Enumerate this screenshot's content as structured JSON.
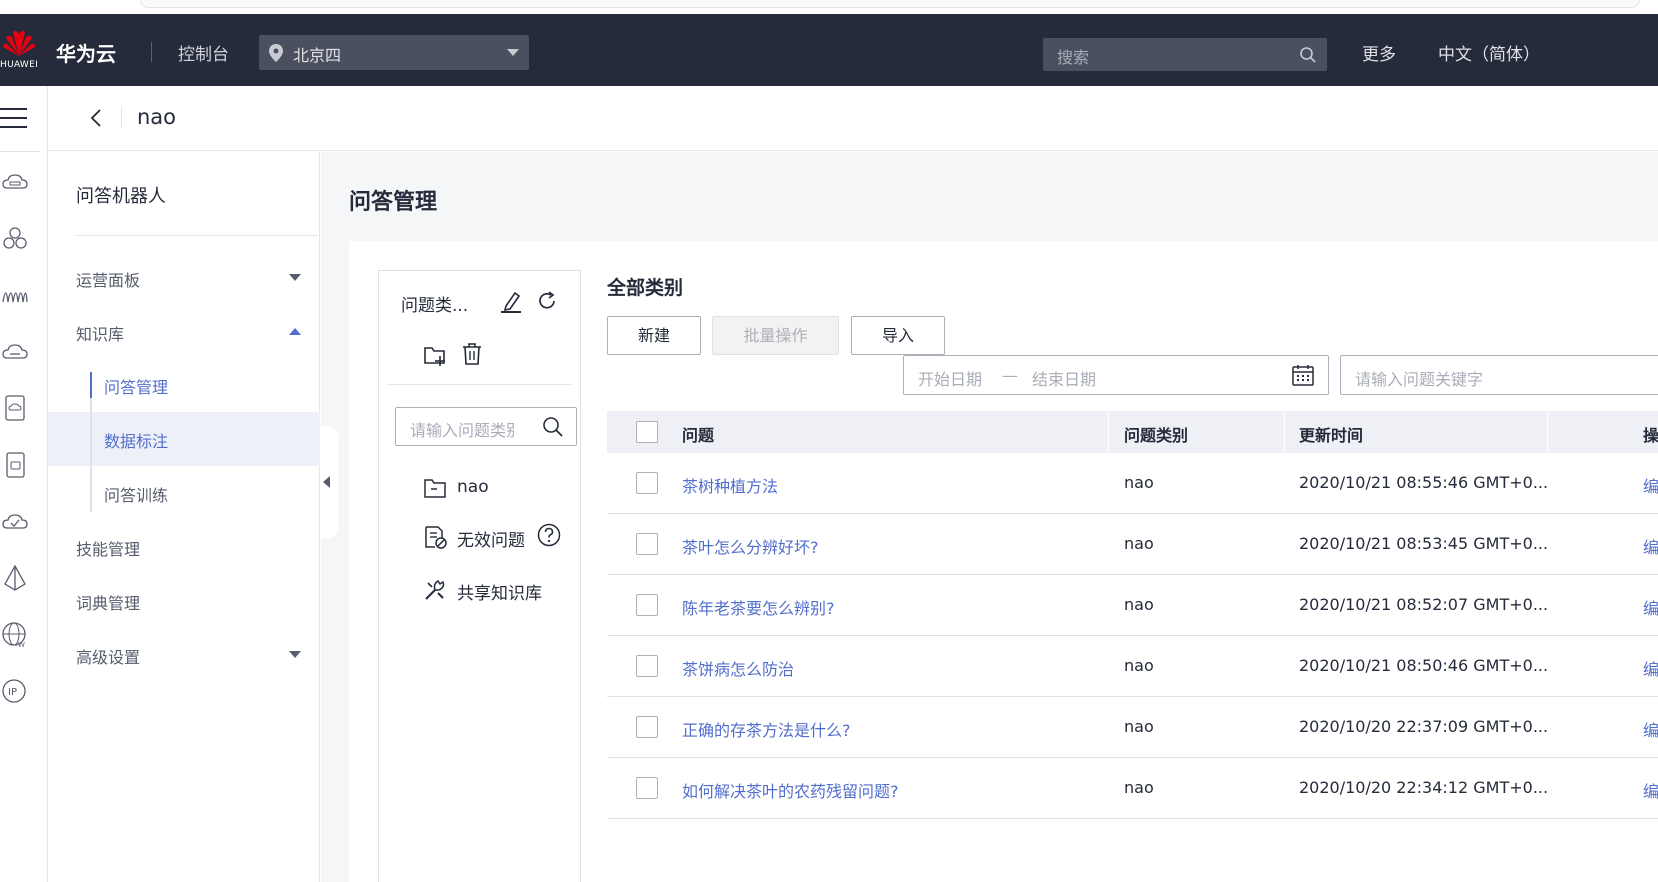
{
  "topbar": {
    "brand": "HUAWEI",
    "cloud_name": "华为云",
    "console": "控制台",
    "region": "北京四",
    "search_placeholder": "搜索",
    "more": "更多",
    "language": "中文（简体）"
  },
  "header": {
    "title": "nao"
  },
  "sidebar": {
    "title": "问答机器人",
    "items": [
      {
        "label": "运营面板"
      },
      {
        "label": "知识库"
      },
      {
        "label": "技能管理"
      },
      {
        "label": "词典管理"
      },
      {
        "label": "高级设置"
      }
    ],
    "knowledge_sub": [
      {
        "label": "问答管理"
      },
      {
        "label": "数据标注"
      },
      {
        "label": "问答训练"
      }
    ]
  },
  "page": {
    "title": "问答管理"
  },
  "category_panel": {
    "title": "问题类...",
    "search_placeholder": "请输入问题类别",
    "nodes": [
      {
        "label": "nao",
        "icon": "folder-icon"
      },
      {
        "label": "无效问题",
        "icon": "invalid-doc-icon"
      },
      {
        "label": "共享知识库",
        "icon": "tools-icon"
      }
    ]
  },
  "main": {
    "title": "全部类别",
    "buttons": {
      "new": "新建",
      "batch": "批量操作",
      "import": "导入"
    },
    "date_start": "开始日期",
    "date_dash": "—",
    "date_end": "结束日期",
    "keyword_placeholder": "请输入问题关键字"
  },
  "table": {
    "columns": [
      "问题",
      "问题类别",
      "更新时间",
      "操"
    ],
    "rows": [
      {
        "question": "茶树种植方法",
        "category": "nao",
        "updated": "2020/10/21 08:55:46 GMT+0...",
        "op": "编"
      },
      {
        "question": "茶叶怎么分辨好坏?",
        "category": "nao",
        "updated": "2020/10/21 08:53:45 GMT+0...",
        "op": "编"
      },
      {
        "question": "陈年老茶要怎么辨别?",
        "category": "nao",
        "updated": "2020/10/21 08:52:07 GMT+0...",
        "op": "编"
      },
      {
        "question": "茶饼病怎么防治",
        "category": "nao",
        "updated": "2020/10/21 08:50:46 GMT+0...",
        "op": "编"
      },
      {
        "question": "正确的存茶方法是什么?",
        "category": "nao",
        "updated": "2020/10/20 22:37:09 GMT+0...",
        "op": "编"
      },
      {
        "question": "如何解决茶叶的农药残留问题?",
        "category": "nao",
        "updated": "2020/10/20 22:34:12 GMT+0...",
        "op": "编"
      }
    ]
  },
  "colors": {
    "topbar_bg": "#252b3a",
    "accent": "#526ecc",
    "content_bg": "#f5f6f8",
    "huawei_red": "#e60012"
  }
}
